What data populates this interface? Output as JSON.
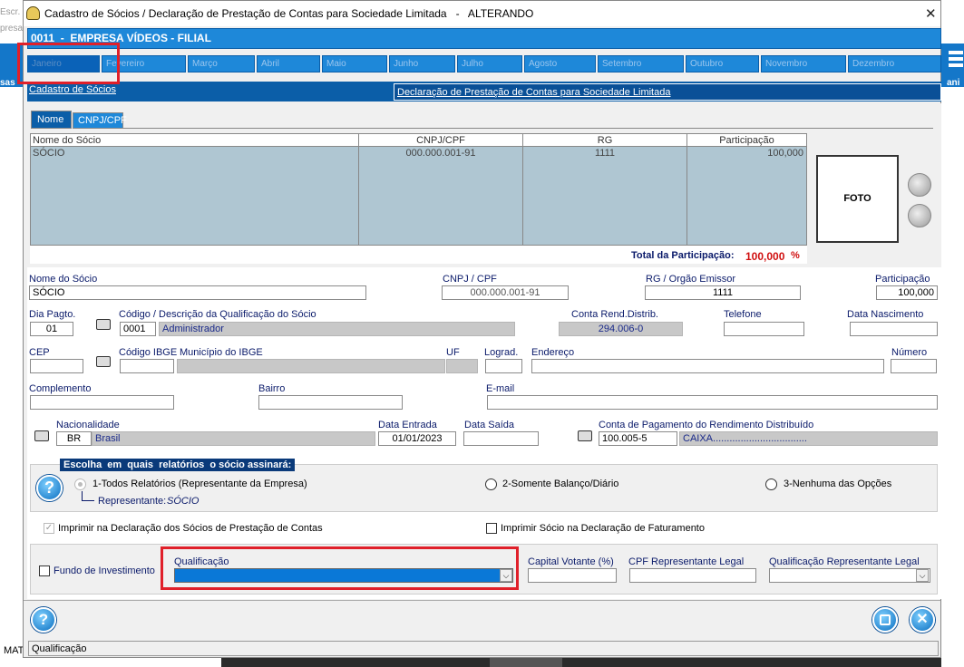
{
  "bg": {
    "left_top": "Escr.",
    "left_mid": "presa",
    "left_side": "sas",
    "right_side": "ani",
    "bottom_left": "MAT"
  },
  "window": {
    "title": "Cadastro de Sócios / Declaração de Prestação de Contas para Sociedade Limitada   -   ALTERANDO",
    "close": "✕"
  },
  "company": "0011  -  EMPRESA VÍDEOS - FILIAL",
  "months": [
    "Janeiro",
    "Fevereiro",
    "Março",
    "Abril",
    "Maio",
    "Junho",
    "Julho",
    "Agosto",
    "Setembro",
    "Outubro",
    "Novembro",
    "Dezembro"
  ],
  "tabs": {
    "socios": "Cadastro de Sócios",
    "declaracao": "Declaração de Prestação de Contas para Sociedade Limitada"
  },
  "subtabs": {
    "nome": "Nome",
    "cnpj": "CNPJ/CPF"
  },
  "grid": {
    "headers": [
      "Nome do Sócio",
      "CNPJ/CPF",
      "RG",
      "Participação"
    ],
    "rows": [
      [
        "SÓCIO",
        "000.000.001-91",
        "1111",
        "100,000"
      ]
    ],
    "total_label": "Total da Participação:",
    "total_value": "100,000",
    "total_unit": "%"
  },
  "foto": "FOTO",
  "form": {
    "nome_label": "Nome do Sócio",
    "nome": "SÓCIO",
    "cnpj_label": "CNPJ / CPF",
    "cnpj": "000.000.001-91",
    "rg_label": "RG / Orgão Emissor",
    "rg": "1111",
    "part_label": "Participação",
    "part": "100,000",
    "dia_label": "Dia Pagto.",
    "dia": "01",
    "codigo_label": "Código  /  Descrição da Qualificação do Sócio",
    "codigo": "0001",
    "descricao": "Administrador",
    "conta_rend_label": "Conta Rend.Distrib.",
    "conta_rend": "294.006-0",
    "telefone_label": "Telefone",
    "telefone": "",
    "nasc_label": "Data Nascimento",
    "nasc": "",
    "cep_label": "CEP",
    "cep": "",
    "ibge_label": "Código IBGE",
    "ibge": "",
    "municipio_label": "Município do IBGE",
    "municipio": "",
    "uf_label": "UF",
    "uf": "",
    "lograd_label": "Lograd.",
    "lograd": "",
    "endereco_label": "Endereço",
    "endereco": "",
    "numero_label": "Número",
    "numero": "",
    "complemento_label": "Complemento",
    "complemento": "",
    "bairro_label": "Bairro",
    "bairro": "",
    "email_label": "E-mail",
    "email": "",
    "nac_label": "Nacionalidade",
    "nac_code": "BR",
    "nac_name": "Brasil",
    "entrada_label": "Data Entrada",
    "entrada": "01/01/2023",
    "saida_label": "Data Saída",
    "saida": "",
    "conta_pag_label": "Conta de Pagamento do Rendimento Distribuído",
    "conta_pag": "100.005-5",
    "conta_pag_desc": "CAIXA.................................."
  },
  "reports": {
    "title": "Escolha  em  quais  relatórios  o sócio assinará:",
    "opt1": "1-Todos Relatórios (Representante da Empresa)",
    "opt2": "2-Somente Balanço/Diário",
    "opt3": "3-Nenhuma das Opções",
    "rep_label": "Representante:",
    "rep_value": "SÓCIO"
  },
  "checks": {
    "imprimir_decl": "Imprimir na Declaração dos Sócios de Prestação de Contas",
    "imprimir_fat": "Imprimir Sócio na Declaração de Faturamento",
    "fundo": "Fundo de Investimento"
  },
  "bottom": {
    "qualif_label": "Qualificação",
    "capital_label": "Capital Votante (%)",
    "cpf_rep_label": "CPF Representante Legal",
    "qualif_rep_label": "Qualificação Representante Legal"
  },
  "status": "Qualificação",
  "colors": {
    "accent": "#1e88d9",
    "highlight": "#e0202a",
    "total": "#d01010"
  }
}
